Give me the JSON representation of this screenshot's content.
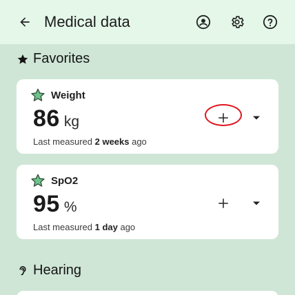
{
  "header": {
    "title": "Medical data",
    "back_icon": "arrow-left-icon",
    "profile_icon": "account-circle-icon",
    "settings_icon": "gear-icon",
    "help_icon": "help-circle-icon"
  },
  "sections": {
    "favorites": {
      "title": "Favorites",
      "icon": "star-icon"
    },
    "hearing": {
      "title": "Hearing",
      "icon": "ear-icon"
    }
  },
  "cards": [
    {
      "name": "Weight",
      "value": "86",
      "unit": "kg",
      "meta_prefix": "Last measured ",
      "meta_bold": "2 weeks",
      "meta_suffix": " ago",
      "add_icon": "plus-icon",
      "dropdown_icon": "caret-down-icon",
      "favorite_icon": "star-filled-icon"
    },
    {
      "name": "SpO2",
      "value": "95",
      "unit": "%",
      "meta_prefix": "Last measured ",
      "meta_bold": "1 day",
      "meta_suffix": " ago",
      "add_icon": "plus-icon",
      "dropdown_icon": "caret-down-icon",
      "favorite_icon": "star-filled-icon"
    }
  ],
  "colors": {
    "background": "#cfe6d6",
    "topbar": "#e4f7e9",
    "card": "#ffffff",
    "star_fill": "#6fc28c",
    "highlight": "#e0151c"
  }
}
